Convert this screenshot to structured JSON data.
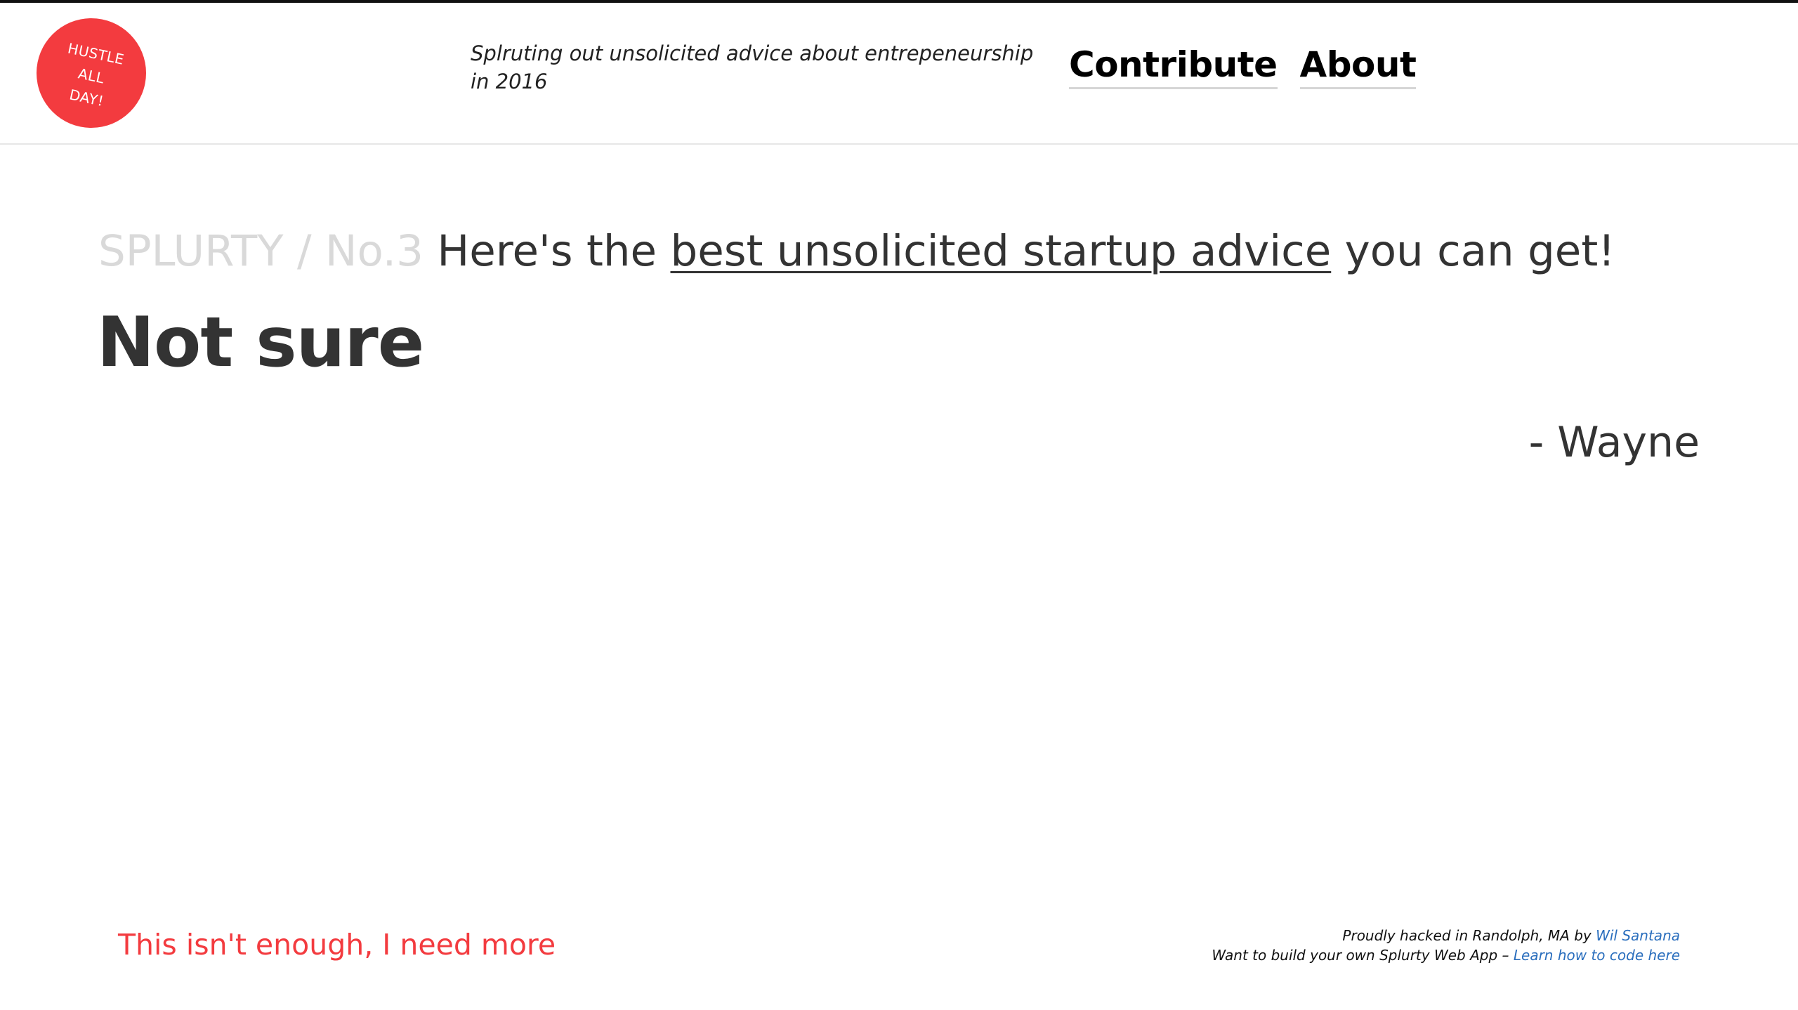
{
  "header": {
    "logo_lines": [
      "HUSTLE",
      "ALL",
      "DAY!"
    ],
    "tagline": "Splruting out unsolicited advice about entrepeneurship in 2016",
    "nav": [
      "Contribute",
      "About"
    ]
  },
  "main": {
    "crumb": "SPLURTY / No.3",
    "headline_pre": "Here's the",
    "headline_link": "best unsolicited startup advice",
    "headline_post": "you can get!",
    "advice": "Not sure",
    "author": "- Wayne"
  },
  "footer": {
    "more_link": "This isn't enough, I need more",
    "credit_text": "Proudly hacked in Randolph, MA by",
    "credit_link": "Wil Santana",
    "build_text": "Want to build your own Splurty Web App –",
    "build_link": "Learn how to code here"
  },
  "colors": {
    "brand_red": "#f33b3f",
    "link_blue": "#2a6ebd",
    "text_dark": "#333333",
    "crumb_gray": "#d9d9d9"
  }
}
